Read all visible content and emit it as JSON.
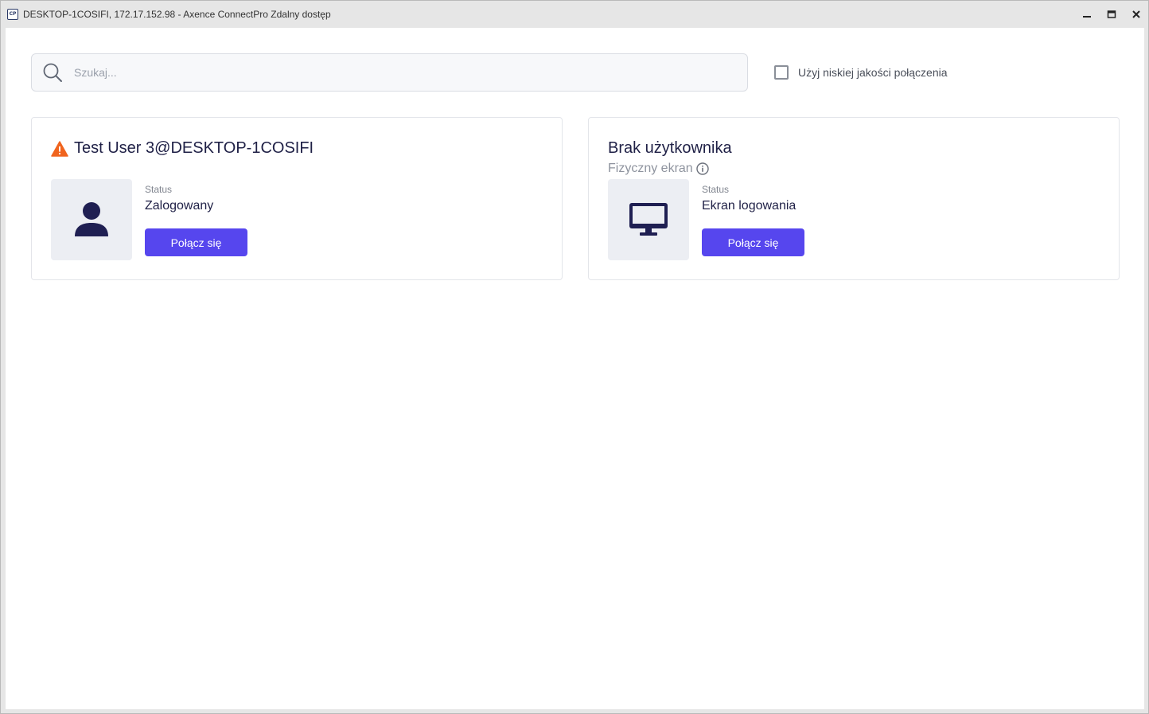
{
  "window": {
    "title": "DESKTOP-1COSIFI, 172.17.152.98 - Axence ConnectPro Zdalny dostęp",
    "app_icon_text": "CP",
    "controls": [
      "minimize-icon",
      "maximize-icon",
      "close-icon"
    ]
  },
  "search": {
    "placeholder": "Szukaj...",
    "value": ""
  },
  "low_quality": {
    "label": "Użyj niskiej jakości połączenia",
    "checked": false
  },
  "sessions": [
    {
      "title": "Test User 3@DESKTOP-1COSIFI",
      "warning": true,
      "icon": "user-icon",
      "status_label": "Status",
      "status_value": "Zalogowany",
      "button_label": "Połącz się"
    },
    {
      "title": "Brak użytkownika",
      "subtitle": "Fizyczny ekran",
      "icon": "monitor-icon",
      "status_label": "Status",
      "status_value": "Ekran logowania",
      "button_label": "Połącz się"
    }
  ],
  "colors": {
    "accent": "#5646ee",
    "title_text": "#1f2046",
    "warning": "#f0641e",
    "icon_dark": "#1f1f52"
  }
}
